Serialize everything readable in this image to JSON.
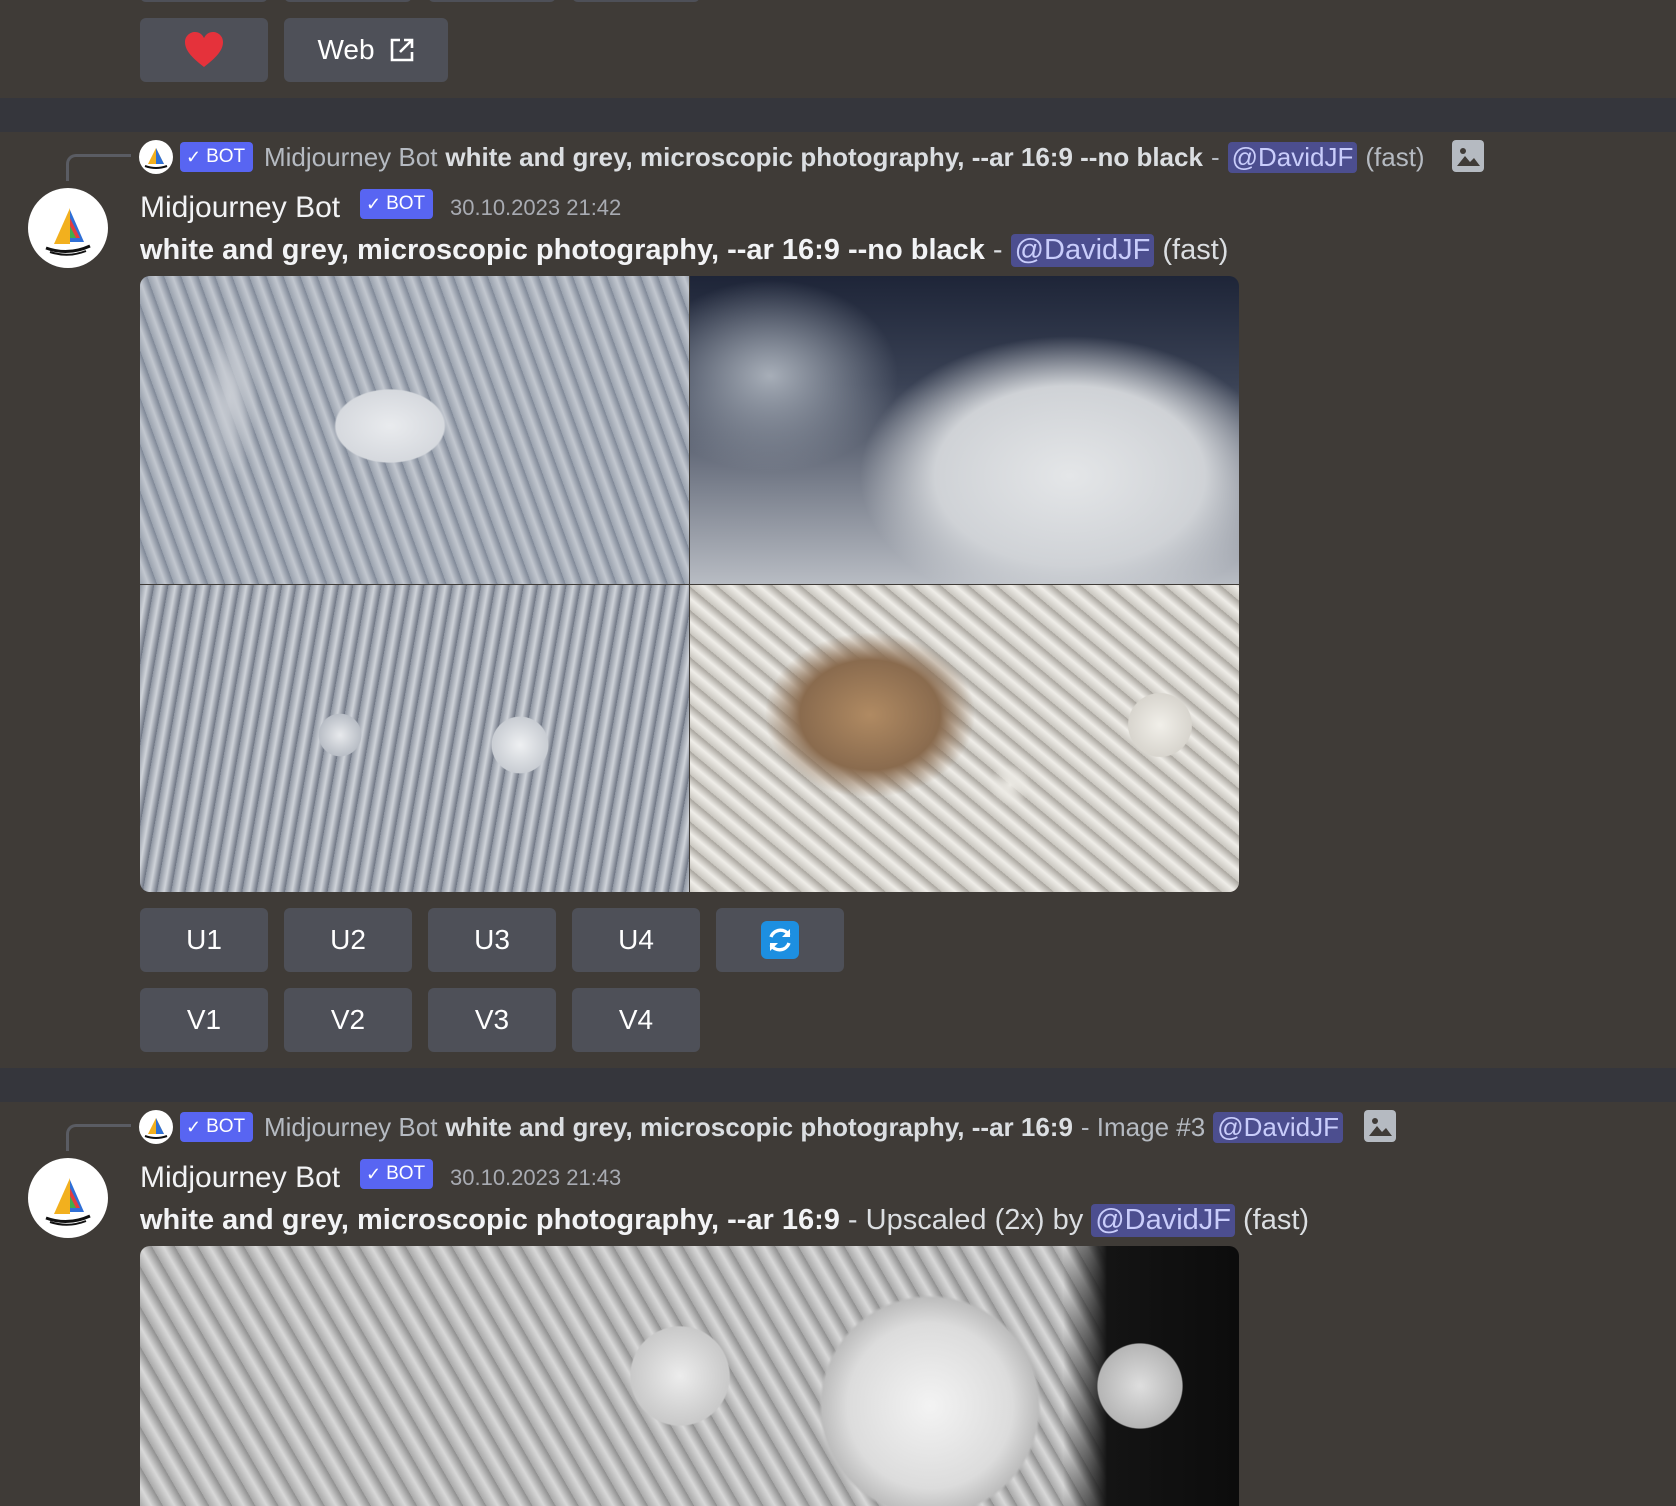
{
  "top_buttons": {
    "heart_icon": "heart-icon",
    "web_label": "Web",
    "web_icon": "external-link-icon"
  },
  "msg1": {
    "reply": {
      "bot_tag": "BOT",
      "author": "Midjourney Bot",
      "prompt": "white and grey, microscopic photography, --ar 16:9 --no black",
      "sep": "-",
      "mention": "@DavidJF",
      "suffix": "(fast)"
    },
    "author": "Midjourney Bot",
    "bot_tag": "BOT",
    "timestamp": "30.10.2023 21:42",
    "content": {
      "prompt": "white and grey, microscopic photography, --ar 16:9 --no black",
      "sep": "-",
      "mention": "@DavidJF",
      "suffix": "(fast)"
    },
    "upscale_buttons": [
      "U1",
      "U2",
      "U3",
      "U4"
    ],
    "variation_buttons": [
      "V1",
      "V2",
      "V3",
      "V4"
    ],
    "reroll_icon": "refresh-icon"
  },
  "msg2": {
    "reply": {
      "bot_tag": "BOT",
      "author": "Midjourney Bot",
      "prompt": "white and grey, microscopic photography, --ar 16:9",
      "middle": "- Image #3",
      "mention": "@DavidJF"
    },
    "author": "Midjourney Bot",
    "bot_tag": "BOT",
    "timestamp": "30.10.2023 21:43",
    "content": {
      "prompt": "white and grey, microscopic photography, --ar 16:9",
      "middle": "- Upscaled (2x) by",
      "mention": "@DavidJF",
      "suffix": "(fast)"
    }
  },
  "colors": {
    "background": "#3f3b37",
    "button": "#4e5058",
    "bot_tag": "#5865f2",
    "mention_bg": "#4c4e8f",
    "heart": "#e5323b",
    "reroll": "#1d8fe1"
  }
}
